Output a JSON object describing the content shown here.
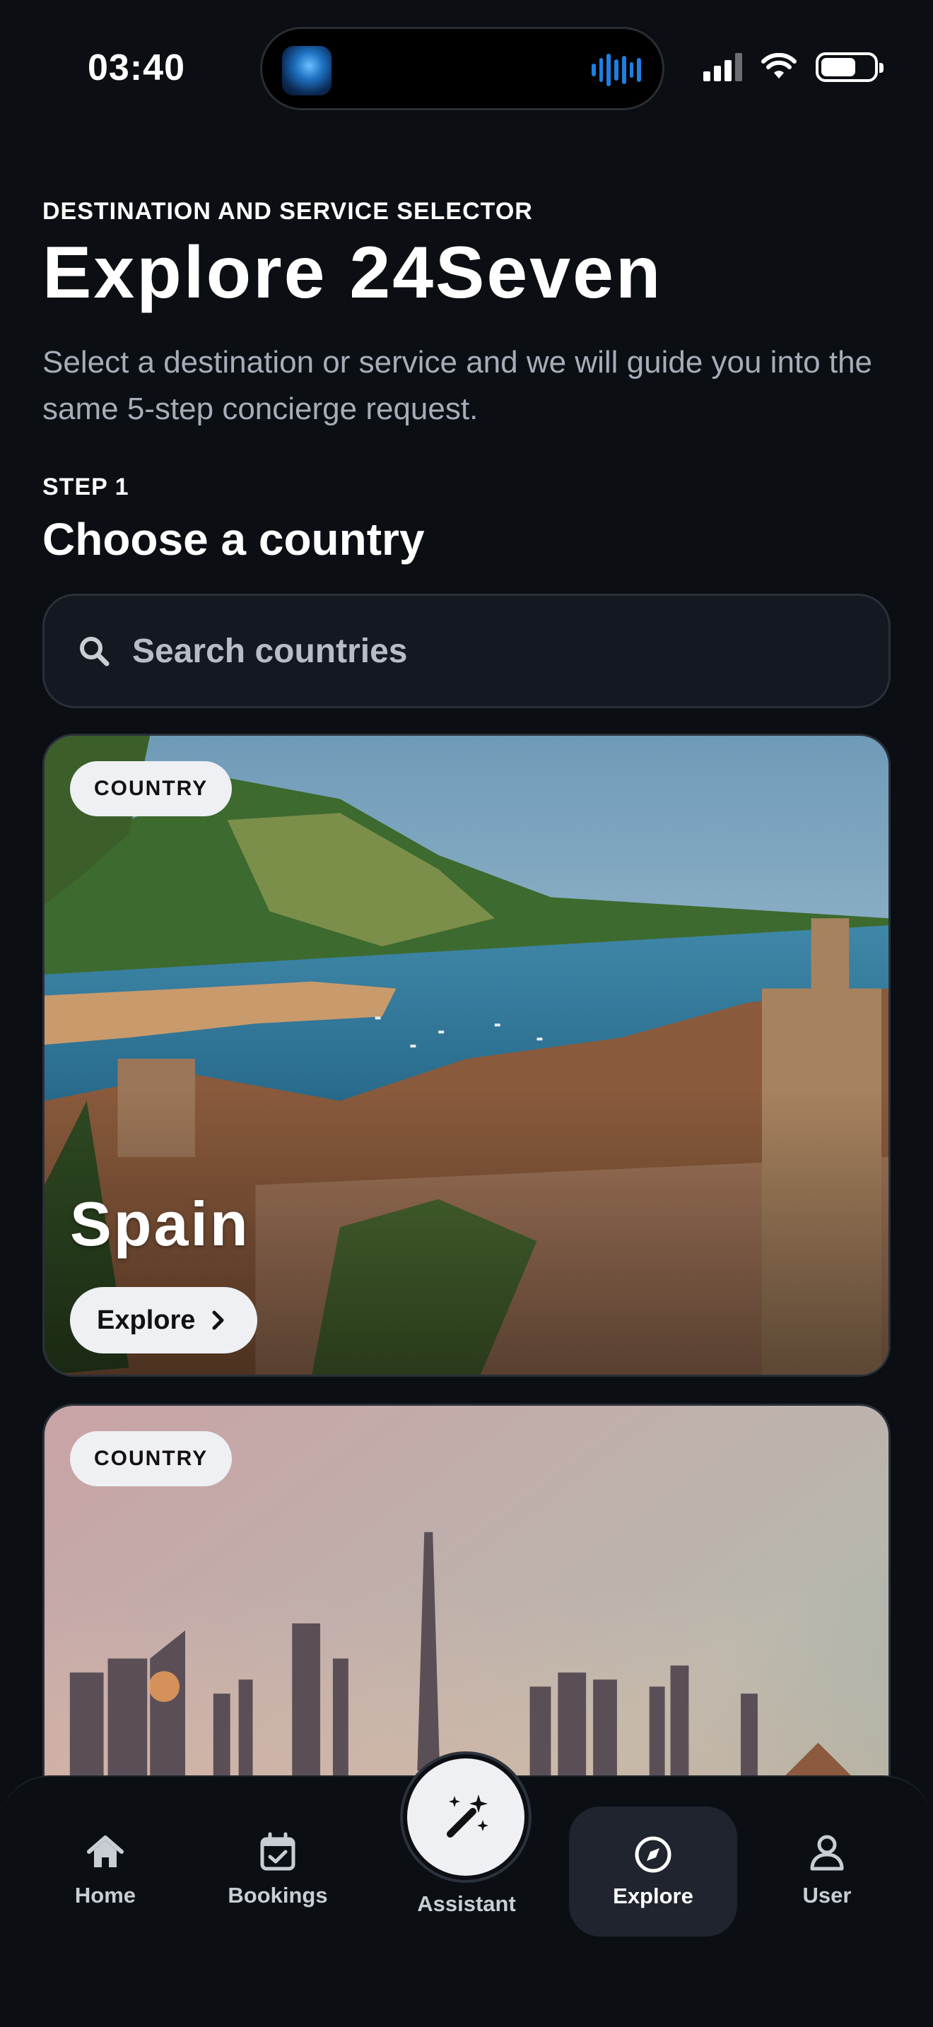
{
  "status_bar": {
    "time": "03:40",
    "icons": [
      "now-playing-art",
      "audio-wave-icon",
      "cellular-signal-icon",
      "wifi-icon",
      "battery-icon"
    ]
  },
  "header": {
    "eyebrow": "DESTINATION AND SERVICE SELECTOR",
    "title": "Explore 24Seven",
    "subtitle": "Select a destination or service and we will guide you into the same 5-step concierge request."
  },
  "step": {
    "label": "STEP 1",
    "title": "Choose a country"
  },
  "search": {
    "placeholder": "Search countries",
    "value": ""
  },
  "cards": [
    {
      "badge": "COUNTRY",
      "name": "Spain",
      "button_label": "Explore"
    },
    {
      "badge": "COUNTRY"
    }
  ],
  "nav": {
    "items": [
      {
        "label": "Home",
        "icon": "home-icon"
      },
      {
        "label": "Bookings",
        "icon": "calendar-check-icon"
      },
      {
        "label": "Assistant",
        "icon": "magic-wand-icon"
      },
      {
        "label": "Explore",
        "icon": "compass-icon",
        "active": true
      },
      {
        "label": "User",
        "icon": "user-icon"
      }
    ]
  },
  "colors": {
    "background": "#0b0e13",
    "surface": "#141821",
    "active_tab": "#1f242e",
    "chip": "#eef0f3",
    "muted_text": "#a7adb8"
  }
}
